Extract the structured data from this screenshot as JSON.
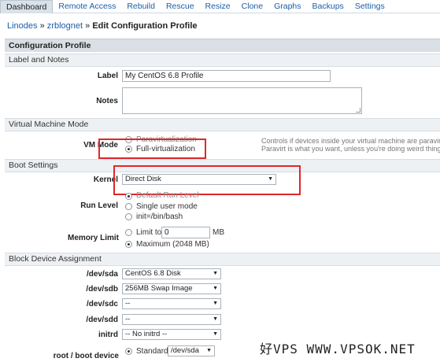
{
  "tabs": [
    {
      "label": "Dashboard",
      "active": true
    },
    {
      "label": "Remote Access"
    },
    {
      "label": "Rebuild"
    },
    {
      "label": "Rescue"
    },
    {
      "label": "Resize"
    },
    {
      "label": "Clone"
    },
    {
      "label": "Graphs"
    },
    {
      "label": "Backups"
    },
    {
      "label": "Settings"
    }
  ],
  "breadcrumb": {
    "linodes": "Linodes",
    "sep": "»",
    "node": "zrblognet",
    "current": "Edit Configuration Profile"
  },
  "panel_title": "Configuration Profile",
  "sections": {
    "label_notes": "Label and Notes",
    "vm_mode": "Virtual Machine Mode",
    "boot": "Boot Settings",
    "block": "Block Device Assignment"
  },
  "fields": {
    "label": {
      "label": "Label",
      "value": "My CentOS 6.8 Profile"
    },
    "notes": {
      "label": "Notes",
      "value": ""
    },
    "vm_mode": {
      "label": "VM Mode",
      "options": [
        "Paravirtualization",
        "Full-virtualization"
      ],
      "selected": 1,
      "hint_line1": "Controls if devices inside your virtual machine are paravirtu",
      "hint_line2": "Paravirt is what you want, unless you're doing weird things."
    },
    "kernel": {
      "label": "Kernel",
      "value": "Direct Disk"
    },
    "run_level": {
      "label": "Run Level",
      "options": [
        "Default Run Level",
        "Single user mode",
        "init=/bin/bash"
      ],
      "selected": 0
    },
    "memory_limit": {
      "label": "Memory Limit",
      "limit_to": "Limit to",
      "limit_value": "0",
      "unit": "MB",
      "maximum": "Maximum (2048 MB)",
      "selected": 1
    },
    "devices": [
      {
        "label": "/dev/sda",
        "value": "CentOS 6.8 Disk"
      },
      {
        "label": "/dev/sdb",
        "value": "256MB Swap Image"
      },
      {
        "label": "/dev/sdc",
        "value": "--"
      },
      {
        "label": "/dev/sdd",
        "value": "--"
      }
    ],
    "initrd": {
      "label": "initrd",
      "value": "-- No initrd --"
    },
    "root_device": {
      "label": "root / boot device",
      "standard": "Standard:",
      "value": "/dev/sda"
    }
  },
  "watermark": "好VPS WWW.VPSOK.NET",
  "colors": {
    "link": "#1b5ea8",
    "highlight": "#e0262b",
    "section_bg": "#eef1f4"
  }
}
